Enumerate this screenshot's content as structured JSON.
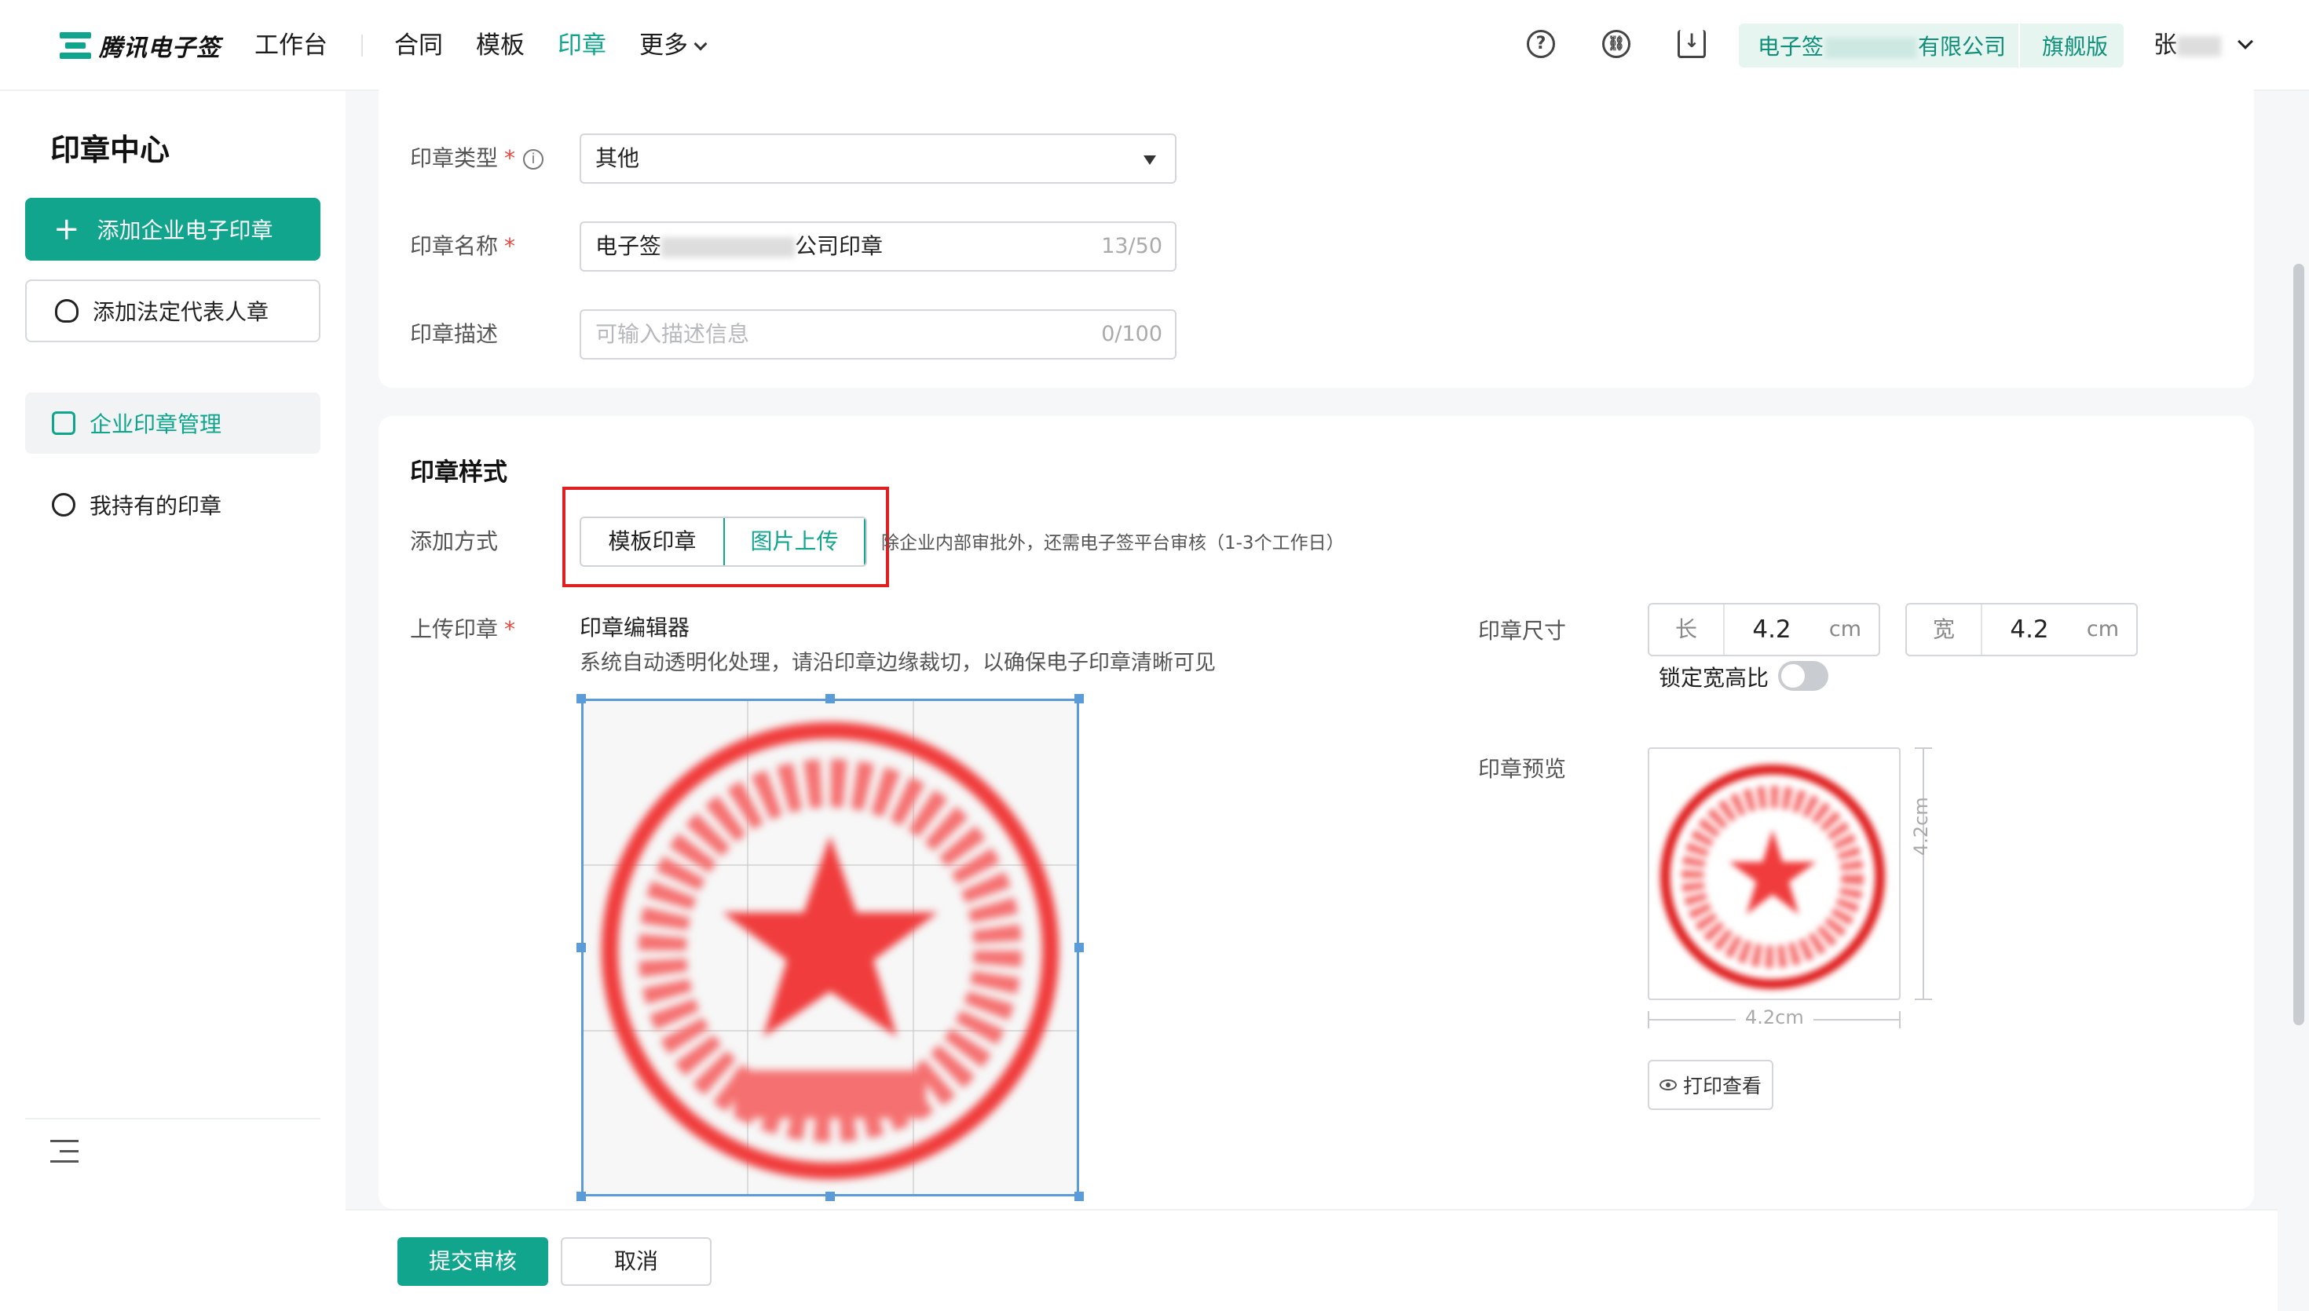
{
  "topbar": {
    "logo_text": "腾讯电子签",
    "nav": [
      "工作台",
      "合同",
      "模板",
      "印章",
      "更多"
    ],
    "active_nav": "印章",
    "icons": [
      "help-icon",
      "link-icon",
      "download-icon"
    ],
    "company_prefix": "电子签",
    "company_suffix": "有限公司",
    "edition": "旗舰版",
    "user_name": "张"
  },
  "sidebar": {
    "title": "印章中心",
    "add_enterprise_seal": "添加企业电子印章",
    "add_legal_rep_seal": "添加法定代表人章",
    "menu": [
      {
        "label": "企业印章管理",
        "active": true
      },
      {
        "label": "我持有的印章",
        "active": false
      }
    ]
  },
  "form": {
    "seal_type_label": "印章类型",
    "seal_type_value": "其他",
    "seal_name_label": "印章名称",
    "seal_name_prefix": "电子签",
    "seal_name_suffix": "公司印章",
    "seal_name_counter": "13/50",
    "seal_desc_label": "印章描述",
    "seal_desc_placeholder": "可输入描述信息",
    "seal_desc_counter": "0/100"
  },
  "style": {
    "section_title": "印章样式",
    "add_method_label": "添加方式",
    "options": [
      "模板印章",
      "图片上传"
    ],
    "selected_option": "图片上传",
    "hint": "除企业内部审批外，还需电子签平台审核（1-3个工作日）",
    "upload_label": "上传印章",
    "editor_title": "印章编辑器",
    "editor_desc": "系统自动透明化处理，请沿印章边缘裁切，以确保电子印章清晰可见",
    "size_label": "印章尺寸",
    "length_key": "长",
    "length_value": "4.2",
    "width_key": "宽",
    "width_value": "4.2",
    "unit": "cm",
    "lock_ratio_label": "锁定宽高比",
    "lock_ratio_on": false,
    "preview_label": "印章预览",
    "preview_dim_v": "4.2cm",
    "preview_dim_h": "4.2cm",
    "print_view": "打印查看",
    "stamp_color": "#f03c3c"
  },
  "footer": {
    "submit": "提交审核",
    "cancel": "取消"
  },
  "colors": {
    "primary": "#12a58e",
    "highlight_box": "#e02020"
  }
}
